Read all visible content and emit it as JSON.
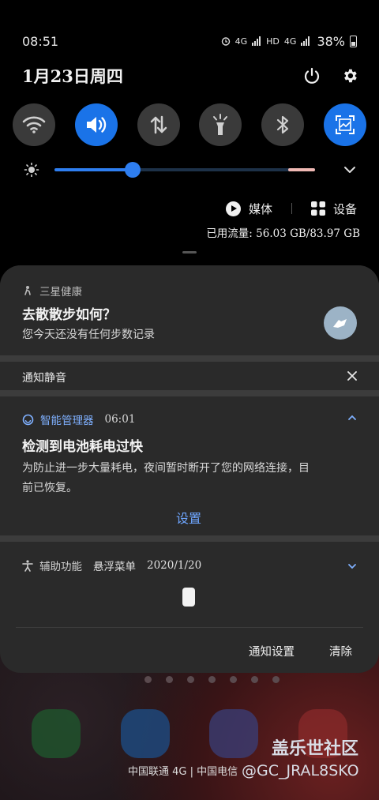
{
  "status": {
    "time": "08:51",
    "net1": "4G",
    "net2": "HD",
    "net3": "4G",
    "battery_pct": "38%"
  },
  "header": {
    "date": "1月23日周四",
    "power_icon": "power-icon",
    "settings_icon": "gear-icon"
  },
  "quick_tiles": [
    {
      "icon": "wifi-icon",
      "on": false
    },
    {
      "icon": "sound-icon",
      "on": true
    },
    {
      "icon": "mobile-data-icon",
      "on": false
    },
    {
      "icon": "flashlight-icon",
      "on": false
    },
    {
      "icon": "bluetooth-icon",
      "on": false
    },
    {
      "icon": "screenshot-icon",
      "on": true
    }
  ],
  "brightness": {
    "level": 0.3,
    "icon": "brightness-icon",
    "colors": {
      "fill": "#2e7ef0",
      "track": "#1d3148",
      "adaptive": "#f0b9b4"
    }
  },
  "media": {
    "media_label": "媒体",
    "devices_label": "设备"
  },
  "data_usage": "已用流量: 56.03 GB/83.97 GB",
  "notifications": {
    "samsung_health": {
      "app": "三星健康",
      "title": "去散散步如何？",
      "body": "您今天还没有任何步数记录"
    },
    "muted": {
      "label": "通知静音"
    },
    "smart_manager": {
      "app": "智能管理器",
      "time": "06:01",
      "title": "检测到电池耗电过快",
      "body_line1": "为防止进一步大量耗电，夜间暂时断开了您的网络连接，目",
      "body_line2": "前已恢复。",
      "action": "设置"
    },
    "accessibility": {
      "app": "辅助功能",
      "sub": "悬浮菜单",
      "date": "2020/1/20"
    },
    "footer": {
      "settings": "通知设置",
      "clear": "清除"
    }
  },
  "bottom": {
    "carrier": "中国联通 4G | 中国电信",
    "watermark_title": "盖乐世社区",
    "watermark_user": "@GC_JRAL8SKO"
  },
  "colors": {
    "accent": "#1a73e8",
    "link": "#6ea6ff",
    "sheet": "#2a2a2a"
  }
}
